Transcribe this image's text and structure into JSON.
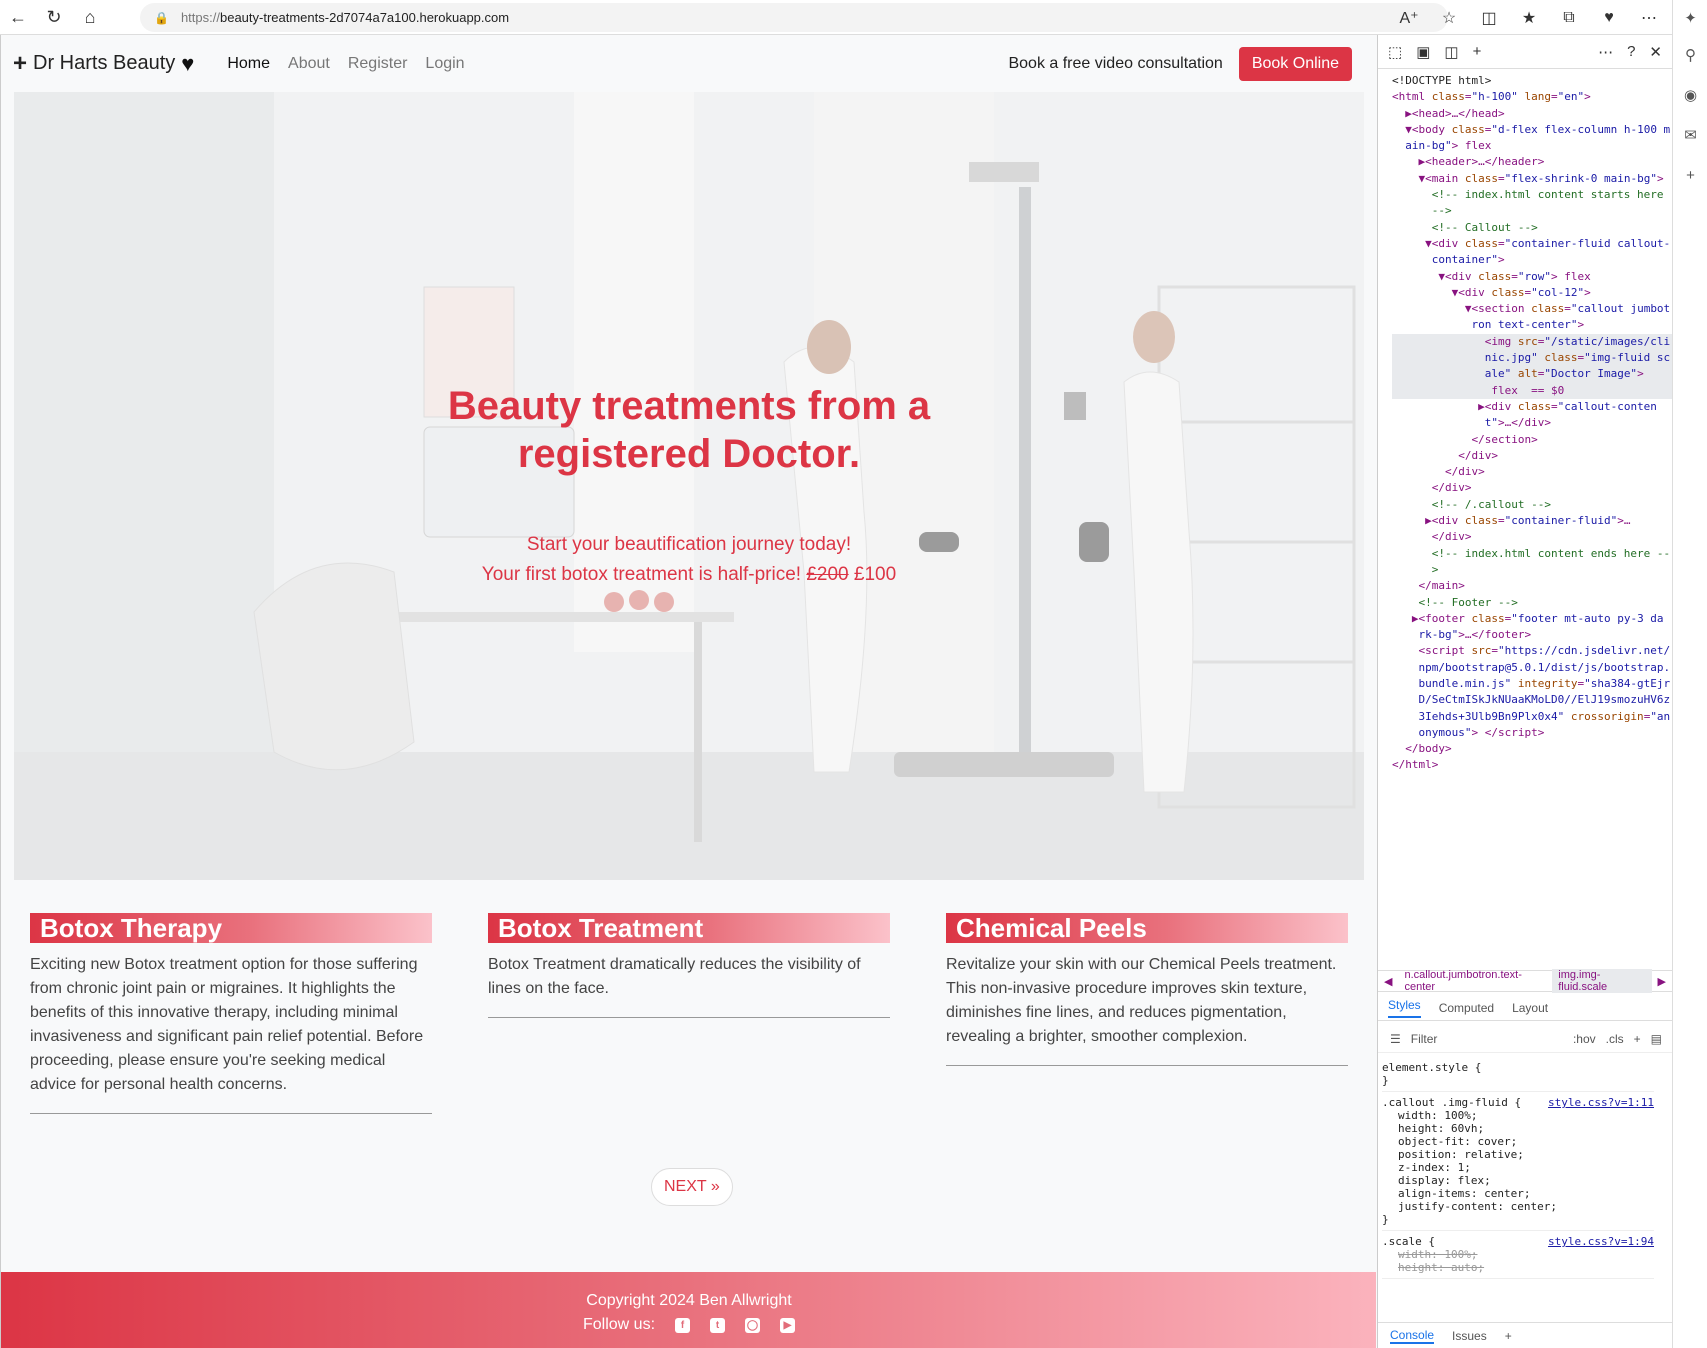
{
  "browser": {
    "url_proto": "https://",
    "url_host": "beauty-treatments-2d7074a7a100.herokuapp.com"
  },
  "site": {
    "brand": "Dr Harts Beauty",
    "nav": [
      "Home",
      "About",
      "Register",
      "Login"
    ],
    "consult_link": "Book a free video consultation",
    "book_button": "Book Online"
  },
  "hero": {
    "title": "Beauty treatments from a registered Doctor.",
    "subtitle": "Start your beautification journey today!",
    "price_text": "Your first botox treatment is half-price!",
    "price_old": "£200",
    "price_new": "£100"
  },
  "cards": [
    {
      "title": "Botox Therapy",
      "body": "Exciting new Botox treatment option for those suffering from chronic joint pain or migraines. It highlights the benefits of this innovative therapy, including minimal invasiveness and significant pain relief potential. Before proceeding, please ensure you're seeking medical advice for personal health concerns."
    },
    {
      "title": "Botox Treatment",
      "body": "Botox Treatment dramatically reduces the visibility of lines on the face."
    },
    {
      "title": "Chemical Peels",
      "body": "Revitalize your skin with our Chemical Peels treatment. This non-invasive procedure improves skin texture, diminishes fine lines, and reduces pigmentation, revealing a brighter, smoother complexion."
    }
  ],
  "pagination": {
    "next": "NEXT »"
  },
  "footer": {
    "copyright": "Copyright 2024 Ben Allwright",
    "follow": "Follow us:"
  },
  "devtools": {
    "breadcrumb_1": "n.callout.jumbotron.text-center",
    "breadcrumb_2": "img.img-fluid.scale",
    "tabs": [
      "Styles",
      "Computed",
      "Layout"
    ],
    "filter_placeholder": "Filter",
    "hov": ":hov",
    "cls": ".cls",
    "element_style": "element.style {",
    "rule1_selector": ".callout .img-fluid {",
    "rule1_link": "style.css?v=1:11",
    "rule1_props": [
      "width: 100%;",
      "height: 60vh;",
      "object-fit: cover;",
      "position: relative;",
      "z-index: 1;",
      "display: flex;",
      "align-items: center;",
      "justify-content: center;"
    ],
    "rule2_selector": ".scale {",
    "rule2_link": "style.css?v=1:94",
    "rule2_props": [
      "width: 100%;",
      "height: auto;"
    ],
    "bottom_tabs": [
      "Console",
      "Issues"
    ]
  },
  "colors": {
    "accent": "#dc3545",
    "footer_gradient_end": "#fbb3bd"
  }
}
